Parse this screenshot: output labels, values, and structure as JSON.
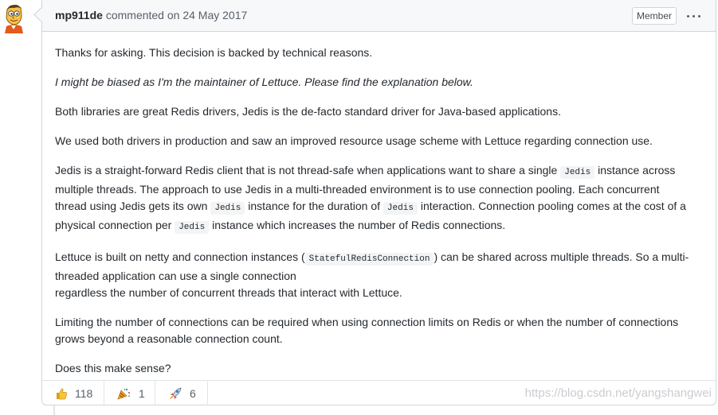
{
  "comment": {
    "author": "mp911de",
    "action": "commented on",
    "date": "24 May 2017",
    "role_badge": "Member",
    "menu_icon": "kebab-horizontal-icon",
    "paragraphs": {
      "p1": "Thanks for asking. This decision is backed by technical reasons.",
      "p2": "I might be biased as I'm the maintainer of Lettuce. Please find the explanation below.",
      "p3": "Both libraries are great Redis drivers, Jedis is the de-facto standard driver for Java-based applications.",
      "p4": "We used both drivers in production and saw an improved resource usage scheme with Lettuce regarding connection use.",
      "p5": {
        "t1": "Jedis is a straight-forward Redis client that is not thread-safe when applications want to share a single ",
        "c1": "Jedis",
        "t2": " instance across multiple threads. The approach to use Jedis in a multi-threaded environment is to use connection pooling. Each concurrent thread using Jedis gets its own ",
        "c2": "Jedis",
        "t3": " instance for the duration of ",
        "c3": "Jedis",
        "t4": " interaction. Connection pooling comes at the cost of a physical connection per ",
        "c4": "Jedis",
        "t5": " instance which increases the number of Redis connections."
      },
      "p6": {
        "t1": "Lettuce is built on netty and connection instances (",
        "c1": "StatefulRedisConnection",
        "t2": ") can be shared across multiple threads. So a multi-threaded application can use a single connection",
        "t3": "regardless the number of concurrent threads that interact with Lettuce."
      },
      "p7": "Limiting the number of connections can be required when using connection limits on Redis or when the number of connections grows beyond a reasonable connection count.",
      "p8": "Does this make sense?"
    }
  },
  "reactions": [
    {
      "icon": "thumbs-up-icon",
      "count": "118"
    },
    {
      "icon": "hooray-icon",
      "count": "1"
    },
    {
      "icon": "rocket-icon",
      "count": "6"
    }
  ],
  "watermark": "https://blog.csdn.net/yangshangwei",
  "colors": {
    "header_bg": "#f6f8fa",
    "border": "#d1d5da",
    "text": "#24292e",
    "muted": "#586069"
  }
}
